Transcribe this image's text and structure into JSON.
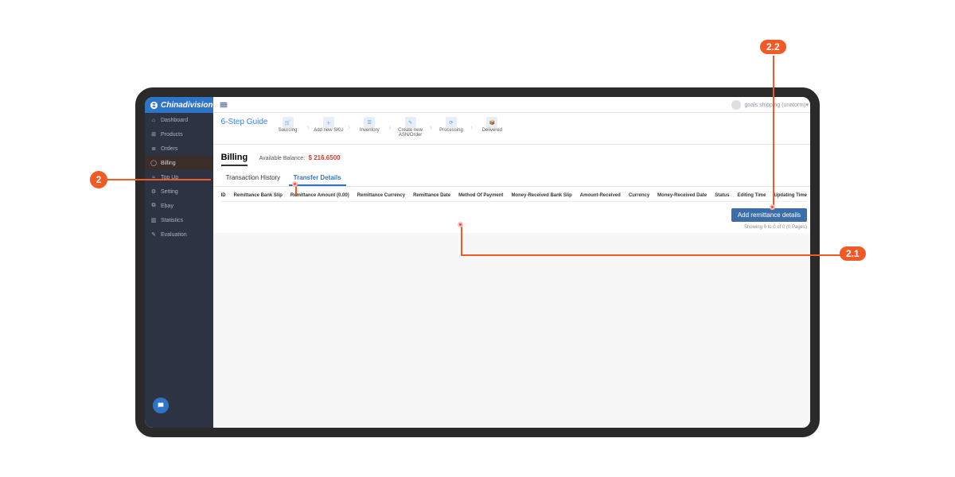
{
  "brand": "Chinadivision",
  "user": {
    "name": "goals shipping (unatorm)▾"
  },
  "sidebar": {
    "items": [
      {
        "label": "Dashboard"
      },
      {
        "label": "Products"
      },
      {
        "label": "Orders"
      },
      {
        "label": "Billing"
      },
      {
        "label": "Top Up"
      },
      {
        "label": "Setting"
      },
      {
        "label": "Ebay"
      },
      {
        "label": "Statistics"
      },
      {
        "label": "Evaluation"
      }
    ]
  },
  "guide": {
    "title": "6-Step Guide",
    "steps": [
      {
        "label": "Sourcing"
      },
      {
        "label": "Add new SKU"
      },
      {
        "label": "Inventory"
      },
      {
        "label": "Create new ASN/Order"
      },
      {
        "label": "Processing"
      },
      {
        "label": "Delivered"
      }
    ]
  },
  "page": {
    "title": "Billing",
    "balance_label": "Available Balance:",
    "balance_value": "$ 216.6500"
  },
  "tabs": [
    {
      "label": "Transaction History"
    },
    {
      "label": "Transfer Details"
    }
  ],
  "columns": [
    "ID",
    "Remittance Bank Slip",
    "Remittance Amount (0.00)",
    "Remittance Currency",
    "Remittance Date",
    "Method Of Payment",
    "Money-Received Bank Slip",
    "Amount-Received",
    "Currency",
    "Money-Received Date",
    "Status",
    "Editing Time",
    "Updating Time"
  ],
  "actions": {
    "add_button": "Add remittance details",
    "pager": "Showing 0 to 0 of 0 (0 Pages)"
  },
  "annotations": {
    "a": "2",
    "b": "2.1",
    "c": "2.2"
  }
}
